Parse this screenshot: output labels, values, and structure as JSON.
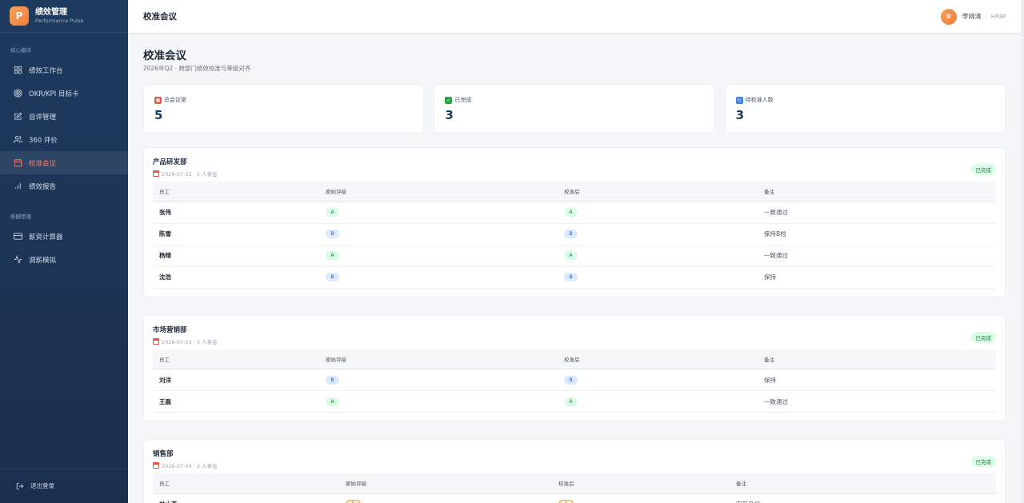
{
  "brand": {
    "logo": "P",
    "title": "绩效管理",
    "subtitle": "Performance Pulse"
  },
  "sidebar": {
    "section1": "核心模块",
    "items1": [
      {
        "label": "绩效工作台",
        "icon": "grid-icon"
      },
      {
        "label": "OKR/KPI 目标卡",
        "icon": "target-icon"
      },
      {
        "label": "自评管理",
        "icon": "edit-icon"
      },
      {
        "label": "360 评价",
        "icon": "users-icon"
      },
      {
        "label": "校准会议",
        "icon": "calendar-icon",
        "active": true
      },
      {
        "label": "绩效报告",
        "icon": "bar-chart-icon"
      }
    ],
    "section2": "薪酬管理",
    "items2": [
      {
        "label": "薪资计算器",
        "icon": "card-icon"
      },
      {
        "label": "调薪模拟",
        "icon": "activity-icon"
      }
    ],
    "logout": "退出登录"
  },
  "header": {
    "title": "校准会议",
    "user_initial": "李",
    "user_name": "李婉清",
    "user_role": "HRBP"
  },
  "page": {
    "title": "校准会议",
    "subtitle": "2026年Q2 · 跨部门绩效校准与等级对齐"
  },
  "stats": [
    {
      "label": "总会议室",
      "value": "5",
      "icon": "calendar-emoji"
    },
    {
      "label": "已完成",
      "value": "3",
      "icon": "check-emoji"
    },
    {
      "label": "待校准人数",
      "value": "3",
      "icon": "refresh-emoji"
    }
  ],
  "table_headers": {
    "employee": "员工",
    "original": "原始评级",
    "calibrated": "校准后",
    "note": "备注"
  },
  "meetings": [
    {
      "dept": "产品研发部",
      "meta": "2026-07-02 · 2 人参会",
      "status": "已完成",
      "rows": [
        {
          "name": "张伟",
          "original": "A",
          "calibrated": "A",
          "note": "一致通过"
        },
        {
          "name": "陈雪",
          "original": "B",
          "calibrated": "B",
          "note": "保持B档"
        },
        {
          "name": "杨晴",
          "original": "A",
          "calibrated": "A",
          "note": "一致通过"
        },
        {
          "name": "沈浩",
          "original": "B",
          "calibrated": "B",
          "note": "保持"
        }
      ]
    },
    {
      "dept": "市场营销部",
      "meta": "2026-07-03 · 2 人参会",
      "status": "已完成",
      "rows": [
        {
          "name": "刘洋",
          "original": "B",
          "calibrated": "B",
          "note": "保持"
        },
        {
          "name": "王磊",
          "original": "A",
          "calibrated": "A",
          "note": "一致通过"
        }
      ]
    },
    {
      "dept": "销售部",
      "meta": "2026-07-04 · 2 人参会",
      "status": "已完成",
      "rows": [
        {
          "name": "林小燕",
          "original": "S",
          "calibrated": "S",
          "note": "实至名归"
        }
      ]
    }
  ]
}
